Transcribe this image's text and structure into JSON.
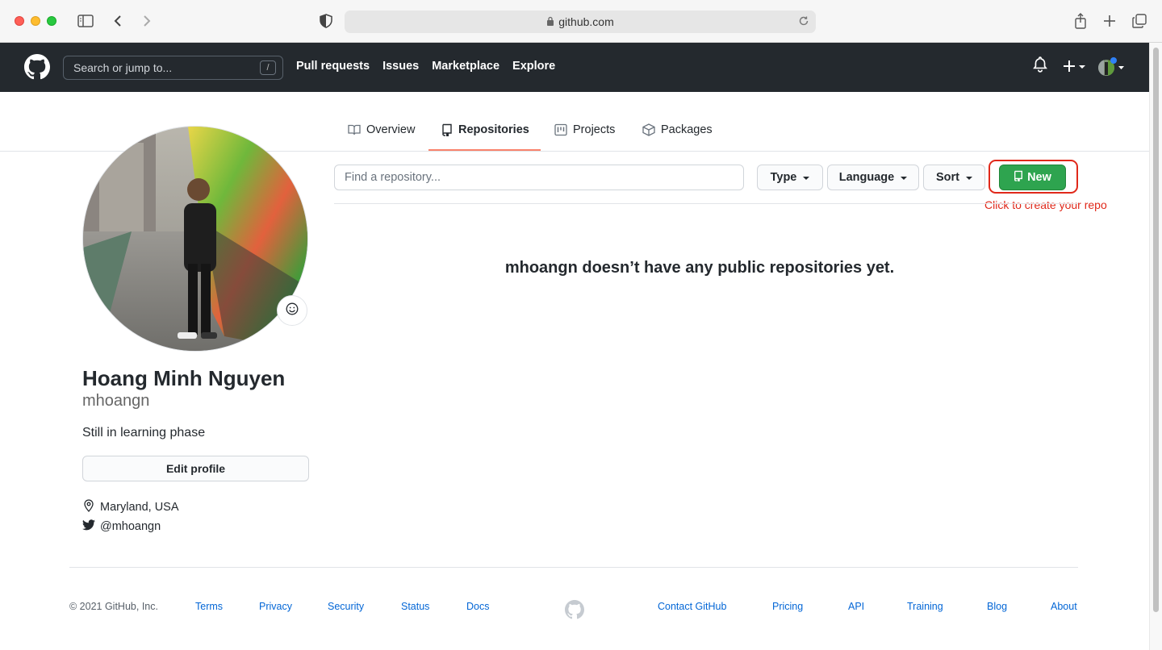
{
  "browser": {
    "url": "github.com"
  },
  "header": {
    "search_placeholder": "Search or jump to...",
    "search_shortcut": "/",
    "nav": [
      "Pull requests",
      "Issues",
      "Marketplace",
      "Explore"
    ]
  },
  "tabs": [
    {
      "label": "Overview",
      "icon": "book-icon"
    },
    {
      "label": "Repositories",
      "icon": "repo-icon",
      "active": true
    },
    {
      "label": "Projects",
      "icon": "project-icon"
    },
    {
      "label": "Packages",
      "icon": "package-icon"
    }
  ],
  "profile": {
    "full_name": "Hoang Minh Nguyen",
    "username": "mhoangn",
    "bio": "Still in learning phase",
    "edit_label": "Edit profile",
    "location": "Maryland, USA",
    "twitter": "@mhoangn"
  },
  "repos": {
    "find_placeholder": "Find a repository...",
    "type_label": "Type",
    "language_label": "Language",
    "sort_label": "Sort",
    "new_label": "New",
    "annotation": "Click to create your repo",
    "empty_message": "mhoangn doesn’t have any public repositories yet."
  },
  "footer": {
    "copyright": "© 2021 GitHub, Inc.",
    "links_left": [
      "Terms",
      "Privacy",
      "Security",
      "Status",
      "Docs"
    ],
    "links_right": [
      "Contact GitHub",
      "Pricing",
      "API",
      "Training",
      "Blog",
      "About"
    ]
  },
  "colors": {
    "header_bg": "#24292e",
    "primary_green": "#2ea44f",
    "link_blue": "#0366d6",
    "annotation_red": "#e0281a",
    "tab_underline": "#f9826c"
  }
}
